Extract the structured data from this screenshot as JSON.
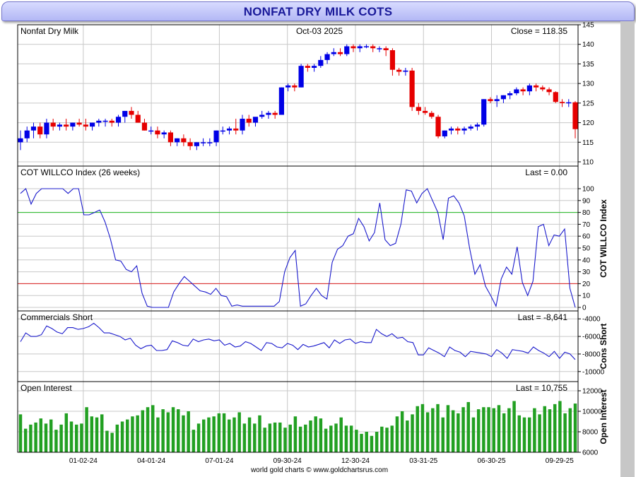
{
  "title": "NONFAT DRY MILK COTS",
  "footer": "world gold charts © www.goldchartsrus.com",
  "colors": {
    "up": "#0000e6",
    "down": "#e60000",
    "line": "#1a1acc",
    "bar": "#22a022",
    "upper_ref": "#22bb22",
    "lower_ref": "#dd2222",
    "grid": "#c8c8c8"
  },
  "x_axis": {
    "tick_labels": [
      "01-02-24",
      "04-01-24",
      "07-01-24",
      "09-30-24",
      "12-30-24",
      "03-31-25",
      "06-30-25",
      "09-29-25"
    ],
    "tick_weeks": [
      12,
      25,
      38,
      51,
      64,
      77,
      90,
      103
    ]
  },
  "chart_data": [
    {
      "type": "candlestick",
      "title": "Nonfat Dry Milk",
      "date_label": "Oct-03  2025",
      "last_label": "Close = 118.35",
      "ylim": [
        110,
        145
      ],
      "yticks": [
        110,
        115,
        120,
        125,
        130,
        135,
        140,
        145
      ],
      "ohlc": [
        [
          115,
          118,
          113,
          116
        ],
        [
          116,
          119,
          115,
          118
        ],
        [
          118,
          120,
          116,
          119
        ],
        [
          119,
          120,
          116,
          117
        ],
        [
          117,
          121,
          116,
          120
        ],
        [
          120,
          121,
          118,
          119
        ],
        [
          119,
          120,
          118,
          119.5
        ],
        [
          119.5,
          121,
          118,
          119
        ],
        [
          119,
          120,
          118,
          120
        ],
        [
          120,
          121,
          119,
          119.5
        ],
        [
          119.5,
          121,
          118,
          119
        ],
        [
          119,
          120,
          118,
          120
        ],
        [
          120,
          121,
          119,
          120.5
        ],
        [
          120.5,
          121,
          119,
          120.5
        ],
        [
          120.5,
          121,
          119,
          120
        ],
        [
          120,
          122,
          119,
          121.5
        ],
        [
          121.5,
          123,
          120,
          123
        ],
        [
          123,
          124,
          121,
          122
        ],
        [
          122,
          123,
          120,
          120
        ],
        [
          120,
          121,
          118,
          118
        ],
        [
          118,
          119,
          117,
          118
        ],
        [
          118,
          119,
          116,
          117
        ],
        [
          117,
          118,
          116,
          117.5
        ],
        [
          117.5,
          118,
          114,
          115
        ],
        [
          115,
          116,
          114,
          116
        ],
        [
          116,
          117,
          114,
          115
        ],
        [
          115,
          116,
          113,
          114
        ],
        [
          114,
          115,
          113,
          115
        ],
        [
          115,
          116,
          114,
          115
        ],
        [
          115,
          116,
          114,
          115
        ],
        [
          115,
          118,
          114,
          118
        ],
        [
          118,
          119,
          117,
          118
        ],
        [
          118,
          119,
          117,
          118.5
        ],
        [
          118.5,
          121,
          117,
          118
        ],
        [
          118,
          122,
          117,
          121
        ],
        [
          121,
          122,
          119,
          120
        ],
        [
          120,
          121,
          119,
          121.5
        ],
        [
          121.5,
          123,
          121,
          122
        ],
        [
          122,
          123,
          121,
          122.5
        ],
        [
          122.5,
          123,
          121,
          122
        ],
        [
          122,
          129,
          122,
          129
        ],
        [
          129,
          130,
          128,
          129.5
        ],
        [
          129.5,
          130,
          128,
          129
        ],
        [
          129,
          135,
          129,
          134.5
        ],
        [
          134.5,
          135,
          133,
          134
        ],
        [
          134,
          135,
          133,
          134.5
        ],
        [
          134.5,
          137,
          134,
          136
        ],
        [
          136,
          138,
          135,
          137.5
        ],
        [
          137.5,
          139,
          137,
          138
        ],
        [
          138,
          139,
          137,
          137.5
        ],
        [
          137.5,
          140,
          137,
          139.5
        ],
        [
          139.5,
          140,
          138,
          139
        ],
        [
          139,
          140,
          138,
          139.5
        ],
        [
          139.5,
          140,
          139,
          139.5
        ],
        [
          139.5,
          140,
          138,
          139
        ],
        [
          139,
          139.5,
          138,
          139
        ],
        [
          139,
          139.5,
          137,
          138.5
        ],
        [
          138.5,
          139,
          132,
          133.5
        ],
        [
          133.5,
          134,
          132,
          133
        ],
        [
          133,
          134,
          132,
          133.3
        ],
        [
          133.3,
          134,
          123,
          124
        ],
        [
          124,
          125,
          122,
          123
        ],
        [
          123,
          124,
          122,
          122.5
        ],
        [
          122.5,
          123,
          121,
          121.5
        ],
        [
          121.5,
          122,
          116,
          116.5
        ],
        [
          116.5,
          118,
          116,
          118
        ],
        [
          118,
          119,
          117,
          118.5
        ],
        [
          118.5,
          119,
          117,
          118
        ],
        [
          118,
          119,
          117,
          118.5
        ],
        [
          118.5,
          119.5,
          118,
          119
        ],
        [
          119,
          120,
          118,
          119.5
        ],
        [
          119.5,
          126,
          119,
          126
        ],
        [
          126,
          126.5,
          125,
          125.5
        ],
        [
          125.5,
          127,
          124,
          126
        ],
        [
          126,
          127,
          125,
          127
        ],
        [
          127,
          128,
          126,
          127.5
        ],
        [
          127.5,
          129,
          127,
          128.5
        ],
        [
          128.5,
          129,
          127,
          128
        ],
        [
          128,
          130,
          127,
          129.5
        ],
        [
          129.5,
          130,
          128,
          129
        ],
        [
          129,
          129.5,
          128,
          128.5
        ],
        [
          128.5,
          129,
          127,
          127.8
        ],
        [
          127.8,
          128,
          125,
          125.3
        ],
        [
          125.3,
          126,
          124,
          125
        ],
        [
          125,
          126,
          124,
          125.2
        ],
        [
          125.2,
          125.5,
          116,
          118.35
        ]
      ]
    },
    {
      "type": "line",
      "title": "COT WILLCO Index (26 weeks)",
      "last_label": "Last = 0.00",
      "side_label": "COT WILLCO Index",
      "ylim": [
        0,
        100
      ],
      "yticks": [
        0,
        10,
        20,
        30,
        40,
        50,
        60,
        70,
        80,
        90,
        100
      ],
      "reference_lines": [
        80,
        20
      ],
      "values": [
        96,
        100,
        87,
        96,
        100,
        100,
        100,
        100,
        100,
        96,
        100,
        100,
        78,
        78,
        80,
        82,
        72,
        58,
        40,
        39,
        32,
        30,
        35,
        12,
        1,
        0,
        0,
        0,
        0,
        13,
        20,
        26,
        22,
        18,
        14,
        13,
        11,
        16,
        10,
        9,
        1,
        2,
        1,
        1,
        1,
        1,
        1,
        1,
        1,
        5,
        30,
        42,
        48,
        1,
        3,
        10,
        16,
        10,
        7,
        38,
        49,
        52,
        60,
        62,
        75,
        68,
        56,
        63,
        88,
        57,
        52,
        54,
        70,
        99,
        98,
        88,
        96,
        100,
        90,
        80,
        57,
        92,
        94,
        88,
        77,
        50,
        28,
        36,
        18,
        10,
        1,
        24,
        34,
        28,
        51,
        21,
        10,
        22,
        68,
        70,
        52,
        61,
        60,
        66,
        16,
        0
      ]
    },
    {
      "type": "line",
      "title": "Commercials Short",
      "last_label": "Last = -8,641",
      "side_label": "Cons Short",
      "ylim": [
        -10500,
        -3500
      ],
      "yticks": [
        -10000,
        -8000,
        -6000,
        -4000
      ],
      "values": [
        -6600,
        -5600,
        -6000,
        -6000,
        -5800,
        -4800,
        -5100,
        -5500,
        -5700,
        -5000,
        -5000,
        -5200,
        -5100,
        -4900,
        -4500,
        -5000,
        -5600,
        -5600,
        -5800,
        -6000,
        -6400,
        -6200,
        -7000,
        -7400,
        -7100,
        -7000,
        -7600,
        -7600,
        -7500,
        -6500,
        -6700,
        -7000,
        -7100,
        -6300,
        -6600,
        -6400,
        -6300,
        -6500,
        -6400,
        -7000,
        -6800,
        -7200,
        -7100,
        -6600,
        -6800,
        -7200,
        -7600,
        -6700,
        -6800,
        -7200,
        -7300,
        -6800,
        -7000,
        -7500,
        -6900,
        -7200,
        -7100,
        -6900,
        -6700,
        -7300,
        -6400,
        -6800,
        -6400,
        -6300,
        -6800,
        -6600,
        -6700,
        -6700,
        -5200,
        -5700,
        -6000,
        -5700,
        -6200,
        -6100,
        -6600,
        -6700,
        -8100,
        -8100,
        -7300,
        -7600,
        -7900,
        -8300,
        -7200,
        -7600,
        -7800,
        -8300,
        -7700,
        -7800,
        -7900,
        -8000,
        -8300,
        -7500,
        -7900,
        -8500,
        -7500,
        -7600,
        -7700,
        -7900,
        -7200,
        -7600,
        -7900,
        -8300,
        -7700,
        -8500,
        -7800,
        -8000,
        -8641
      ]
    },
    {
      "type": "bar",
      "title": "Open Interest",
      "last_label": "Last = 10,755",
      "side_label": "Open Interest",
      "ylim": [
        6000,
        12000
      ],
      "yticks": [
        6000,
        8000,
        10000,
        12000
      ],
      "values": [
        9700,
        8300,
        8700,
        8900,
        9300,
        8800,
        9200,
        8200,
        8700,
        9800,
        9000,
        8700,
        8800,
        10400,
        9500,
        9400,
        9700,
        8100,
        7900,
        8700,
        9000,
        9200,
        9500,
        9600,
        10100,
        10400,
        10600,
        9400,
        10200,
        9900,
        10400,
        10200,
        9600,
        10000,
        8200,
        8800,
        9200,
        9400,
        9500,
        9800,
        9800,
        9200,
        9400,
        9900,
        8800,
        9400,
        8800,
        9600,
        8400,
        8800,
        8900,
        8900,
        8400,
        8700,
        9500,
        8500,
        8700,
        9100,
        9500,
        9300,
        8300,
        8600,
        8800,
        9400,
        8600,
        8600,
        8200,
        7800,
        8000,
        7600,
        8000,
        8500,
        8400,
        8600,
        9500,
        10000,
        9100,
        9700,
        10500,
        10700,
        9900,
        10300,
        10700,
        9400,
        10600,
        10100,
        9800,
        10400,
        10900,
        9400,
        10200,
        10400,
        10400,
        10300,
        10600,
        9800,
        10300,
        11000,
        9600,
        9400,
        9400,
        10300,
        9700,
        10500,
        10200,
        10700,
        11000,
        9800,
        10300,
        10755
      ]
    }
  ]
}
